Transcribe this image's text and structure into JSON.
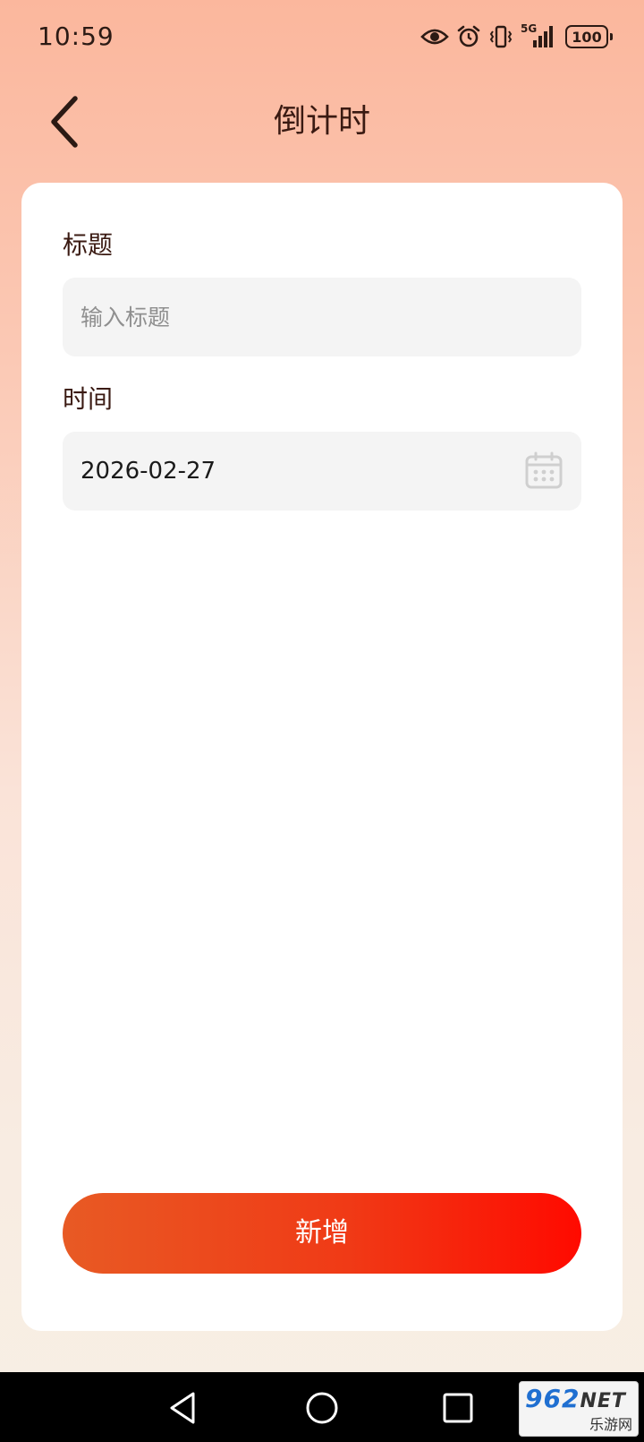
{
  "status_bar": {
    "time": "10:59",
    "network": "5G",
    "battery": "100",
    "icons": [
      "eye-icon",
      "alarm-icon",
      "vibrate-icon",
      "signal-icon",
      "battery-icon"
    ]
  },
  "header": {
    "title": "倒计时",
    "back_icon": "chevron-left-icon"
  },
  "form": {
    "title_label": "标题",
    "title_placeholder": "输入标题",
    "title_value": "",
    "time_label": "时间",
    "time_value": "2026-02-27",
    "time_icon": "calendar-icon"
  },
  "actions": {
    "add_label": "新增"
  },
  "colors": {
    "accent_start": "#e85a24",
    "accent_end": "#ff0a00",
    "title_text": "#3a1a12",
    "field_bg": "#f4f4f4"
  },
  "watermark": {
    "number": "962",
    "suffix": "NET",
    "caption": "乐游网"
  }
}
